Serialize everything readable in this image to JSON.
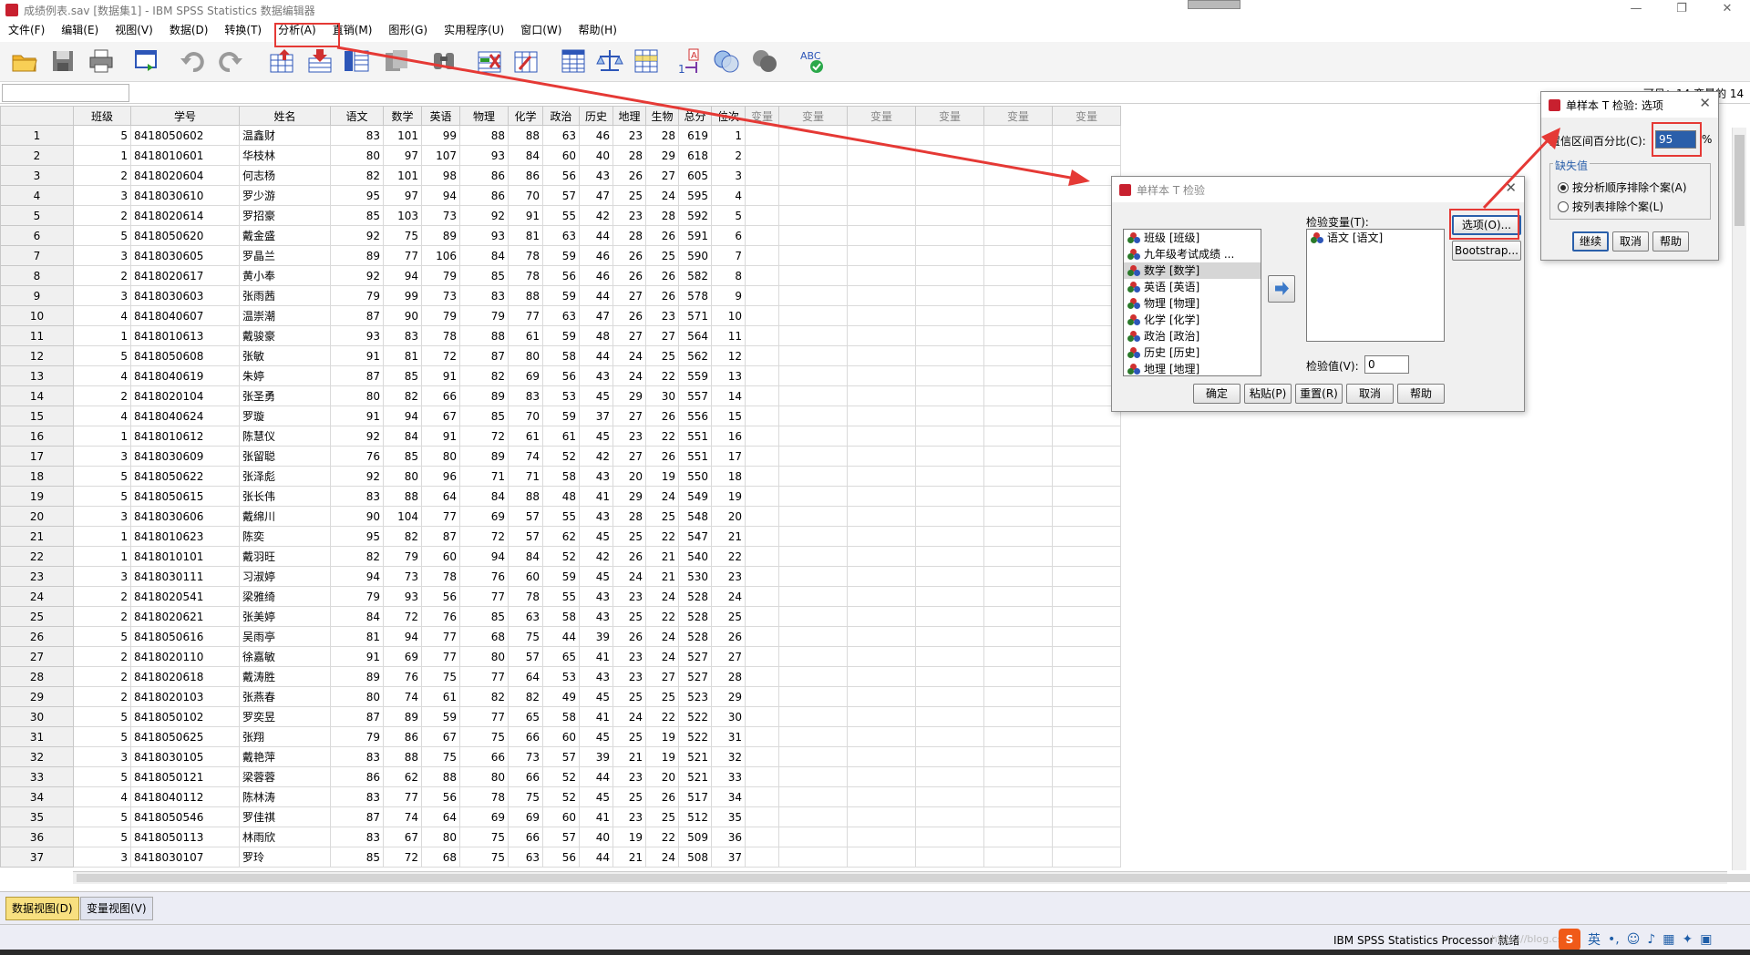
{
  "window": {
    "title": "成绩例表.sav [数据集1] - IBM SPSS Statistics 数据编辑器"
  },
  "menu": [
    "文件(F)",
    "编辑(E)",
    "视图(V)",
    "数据(D)",
    "转换(T)",
    "分析(A)",
    "直销(M)",
    "图形(G)",
    "实用程序(U)",
    "窗口(W)",
    "帮助(H)"
  ],
  "toolbar_icons": [
    "open-icon",
    "save-icon",
    "print-icon",
    "recall-dialog-icon",
    "undo-icon",
    "redo-icon",
    "goto-case-icon",
    "goto-variable-icon",
    "variables-icon",
    "run-descriptives-icon",
    "find-icon",
    "insert-cases-icon",
    "insert-variable-icon",
    "split-file-icon",
    "weight-cases-icon",
    "select-cases-icon",
    "value-labels-icon",
    "use-variable-sets-icon",
    "show-all-variables-icon",
    "spell-check-icon"
  ],
  "info_right": "可见：14 变量的 14",
  "grid": {
    "columns": [
      "班级",
      "学号",
      "姓名",
      "语文",
      "数学",
      "英语",
      "物理",
      "化学",
      "政治",
      "历史",
      "地理",
      "生物",
      "总分",
      "位次",
      "变量",
      "变量",
      "变量",
      "变量",
      "变量",
      "变量"
    ],
    "rows": [
      [
        1,
        5,
        "8418050602",
        "温鑫财",
        83,
        101,
        99,
        88,
        88,
        63,
        46,
        23,
        28,
        619,
        1
      ],
      [
        2,
        1,
        "8418010601",
        "华枝林",
        80,
        97,
        107,
        93,
        84,
        60,
        40,
        28,
        29,
        618,
        2
      ],
      [
        3,
        2,
        "8418020604",
        "何志杨",
        82,
        101,
        98,
        86,
        86,
        56,
        43,
        26,
        27,
        605,
        3
      ],
      [
        4,
        3,
        "8418030610",
        "罗少游",
        95,
        97,
        94,
        86,
        70,
        57,
        47,
        25,
        24,
        595,
        4
      ],
      [
        5,
        2,
        "8418020614",
        "罗招豪",
        85,
        103,
        73,
        92,
        91,
        55,
        42,
        23,
        28,
        592,
        5
      ],
      [
        6,
        5,
        "8418050620",
        "戴金盛",
        92,
        75,
        89,
        93,
        81,
        63,
        44,
        28,
        26,
        591,
        6
      ],
      [
        7,
        3,
        "8418030605",
        "罗晶兰",
        89,
        77,
        106,
        84,
        78,
        59,
        46,
        26,
        25,
        590,
        7
      ],
      [
        8,
        2,
        "8418020617",
        "黄小奉",
        92,
        94,
        79,
        85,
        78,
        56,
        46,
        26,
        26,
        582,
        8
      ],
      [
        9,
        3,
        "8418030603",
        "张雨茜",
        79,
        99,
        73,
        83,
        88,
        59,
        44,
        27,
        26,
        578,
        9
      ],
      [
        10,
        4,
        "8418040607",
        "温崇潮",
        87,
        90,
        79,
        79,
        77,
        63,
        47,
        26,
        23,
        571,
        10
      ],
      [
        11,
        1,
        "8418010613",
        "戴骏豪",
        93,
        83,
        78,
        88,
        61,
        59,
        48,
        27,
        27,
        564,
        11
      ],
      [
        12,
        5,
        "8418050608",
        "张敏",
        91,
        81,
        72,
        87,
        80,
        58,
        44,
        24,
        25,
        562,
        12
      ],
      [
        13,
        4,
        "8418040619",
        "朱婷",
        87,
        85,
        91,
        82,
        69,
        56,
        43,
        24,
        22,
        559,
        13
      ],
      [
        14,
        2,
        "8418020104",
        "张圣勇",
        80,
        82,
        66,
        89,
        83,
        53,
        45,
        29,
        30,
        557,
        14
      ],
      [
        15,
        4,
        "8418040624",
        "罗璇",
        91,
        94,
        67,
        85,
        70,
        59,
        37,
        27,
        26,
        556,
        15
      ],
      [
        16,
        1,
        "8418010612",
        "陈慧仪",
        92,
        84,
        91,
        72,
        61,
        61,
        45,
        23,
        22,
        551,
        16
      ],
      [
        17,
        3,
        "8418030609",
        "张留聪",
        76,
        85,
        80,
        89,
        74,
        52,
        42,
        27,
        26,
        551,
        17
      ],
      [
        18,
        5,
        "8418050622",
        "张泽彪",
        92,
        80,
        96,
        71,
        71,
        58,
        43,
        20,
        19,
        550,
        18
      ],
      [
        19,
        5,
        "8418050615",
        "张长伟",
        83,
        88,
        64,
        84,
        88,
        48,
        41,
        29,
        24,
        549,
        19
      ],
      [
        20,
        3,
        "8418030606",
        "戴绵川",
        90,
        104,
        77,
        69,
        57,
        55,
        43,
        28,
        25,
        548,
        20
      ],
      [
        21,
        1,
        "8418010623",
        "陈奕",
        95,
        82,
        87,
        72,
        57,
        62,
        45,
        25,
        22,
        547,
        21
      ],
      [
        22,
        1,
        "8418010101",
        "戴羽旺",
        82,
        79,
        60,
        94,
        84,
        52,
        42,
        26,
        21,
        540,
        22
      ],
      [
        23,
        3,
        "8418030111",
        "习淑婷",
        94,
        73,
        78,
        76,
        60,
        59,
        45,
        24,
        21,
        530,
        23
      ],
      [
        24,
        2,
        "8418020541",
        "梁雅绮",
        79,
        93,
        56,
        77,
        78,
        55,
        43,
        23,
        24,
        528,
        24
      ],
      [
        25,
        2,
        "8418020621",
        "张美婷",
        84,
        72,
        76,
        85,
        63,
        58,
        43,
        25,
        22,
        528,
        25
      ],
      [
        26,
        5,
        "8418050616",
        "吴雨亭",
        81,
        94,
        77,
        68,
        75,
        44,
        39,
        26,
        24,
        528,
        26
      ],
      [
        27,
        2,
        "8418020110",
        "徐嘉敏",
        91,
        69,
        77,
        80,
        57,
        65,
        41,
        23,
        24,
        527,
        27
      ],
      [
        28,
        2,
        "8418020618",
        "戴涛胜",
        89,
        76,
        75,
        77,
        64,
        53,
        43,
        23,
        27,
        527,
        28
      ],
      [
        29,
        2,
        "8418020103",
        "张燕春",
        80,
        74,
        61,
        82,
        82,
        49,
        45,
        25,
        25,
        523,
        29
      ],
      [
        30,
        5,
        "8418050102",
        "罗奕昱",
        87,
        89,
        59,
        77,
        65,
        58,
        41,
        24,
        22,
        522,
        30
      ],
      [
        31,
        5,
        "8418050625",
        "张翔",
        79,
        86,
        67,
        75,
        66,
        60,
        45,
        25,
        19,
        522,
        31
      ],
      [
        32,
        3,
        "8418030105",
        "戴艳萍",
        83,
        88,
        75,
        66,
        73,
        57,
        39,
        21,
        19,
        521,
        32
      ],
      [
        33,
        5,
        "8418050121",
        "梁蓉蓉",
        86,
        62,
        88,
        80,
        66,
        52,
        44,
        23,
        20,
        521,
        33
      ],
      [
        34,
        4,
        "8418040112",
        "陈林涛",
        83,
        77,
        56,
        78,
        75,
        52,
        45,
        25,
        26,
        517,
        34
      ],
      [
        35,
        5,
        "8418050546",
        "罗佳祺",
        87,
        74,
        64,
        69,
        69,
        60,
        41,
        23,
        25,
        512,
        35
      ],
      [
        36,
        5,
        "8418050113",
        "林雨欣",
        83,
        67,
        80,
        75,
        66,
        57,
        40,
        19,
        22,
        509,
        36
      ],
      [
        37,
        3,
        "8418030107",
        "罗玲",
        85,
        72,
        68,
        75,
        63,
        56,
        44,
        21,
        24,
        508,
        37
      ]
    ]
  },
  "view_tabs": {
    "data_view": "数据视图(D)",
    "variable_view": "变量视图(V)"
  },
  "status": {
    "processor": "IBM SPSS Statistics Processor 就绪",
    "watermark": "https://blog.csdn",
    "tray_lang": "英",
    "tray_ime": "S"
  },
  "dialog_ttest": {
    "title": "单样本 T 检验",
    "source_vars": [
      "班级 [班级]",
      "九年级考试成绩 ...",
      "数学 [数学]",
      "英语 [英语]",
      "物理 [物理]",
      "化学 [化学]",
      "政治 [政治]",
      "历史 [历史]",
      "地理 [地理]"
    ],
    "selected_source_index": 2,
    "test_vars_label": "检验变量(T):",
    "test_vars": [
      "语文 [语文]"
    ],
    "options_btn": "选项(O)...",
    "bootstrap_btn": "Bootstrap...",
    "test_value_label": "检验值(V):",
    "test_value": "0",
    "buttons": [
      "确定",
      "粘贴(P)",
      "重置(R)",
      "取消",
      "帮助"
    ]
  },
  "dialog_options": {
    "title": "单样本 T 检验: 选项",
    "ci_label": "置信区间百分比(C):",
    "ci_value": "95",
    "ci_unit": "%",
    "missing_group": "缺失值",
    "radio1": "按分析顺序排除个案(A)",
    "radio2": "按列表排除个案(L)",
    "radio_selected": 1,
    "buttons": [
      "继续",
      "取消",
      "帮助"
    ]
  },
  "colors": {
    "annotation_red": "#e53935",
    "active_tab": "#f8e080",
    "accent_blue": "#2a5faa"
  }
}
